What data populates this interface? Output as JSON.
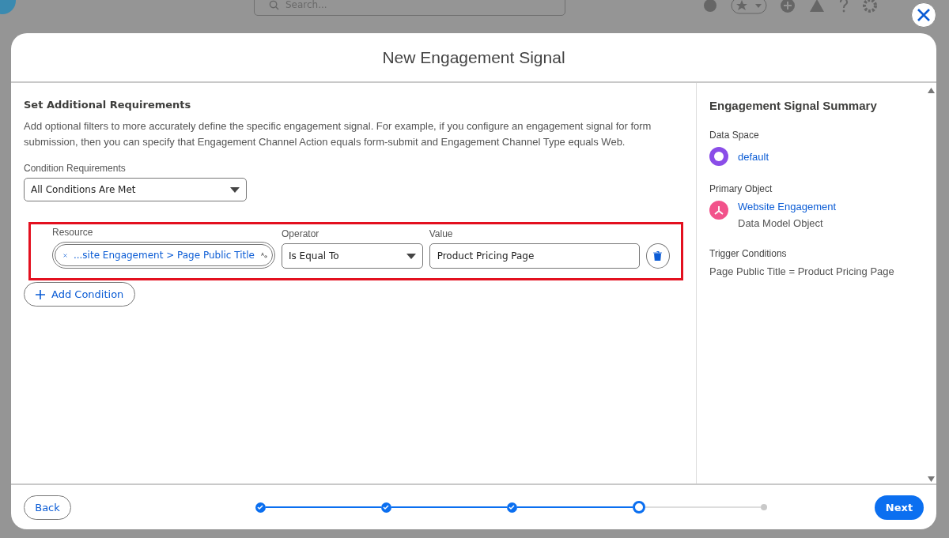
{
  "background": {
    "search": {
      "placeholder": "Search..."
    }
  },
  "modal": {
    "title": "New Engagement Signal",
    "section": {
      "title": "Set Additional Requirements",
      "description": "Add optional filters to more accurately define the specific engagement signal. For example, if you configure an engagement signal for form submission, then you can specify that Engagement Channel Action equals form-submit and Engagement Channel Type equals Web."
    },
    "condition_requirements": {
      "label": "Condition Requirements",
      "value": "All Conditions Are Met"
    },
    "condition": {
      "resource_label": "Resource",
      "resource_value": "...site Engagement > Page Public Title",
      "operator_label": "Operator",
      "operator_value": "Is Equal To",
      "value_label": "Value",
      "value": "Product Pricing Page"
    },
    "add_condition": "Add Condition",
    "summary": {
      "title": "Engagement Signal Summary",
      "data_space_label": "Data Space",
      "data_space": "default",
      "primary_object_label": "Primary Object",
      "primary_object": "Website Engagement",
      "primary_object_type": "Data Model Object",
      "trigger_label": "Trigger Conditions",
      "trigger": "Page Public Title = Product Pricing Page"
    },
    "footer": {
      "back": "Back",
      "next": "Next",
      "steps": [
        {
          "kind": "complete"
        },
        {
          "kind": "complete"
        },
        {
          "kind": "complete"
        },
        {
          "kind": "current"
        },
        {
          "kind": "upcoming"
        }
      ]
    }
  }
}
